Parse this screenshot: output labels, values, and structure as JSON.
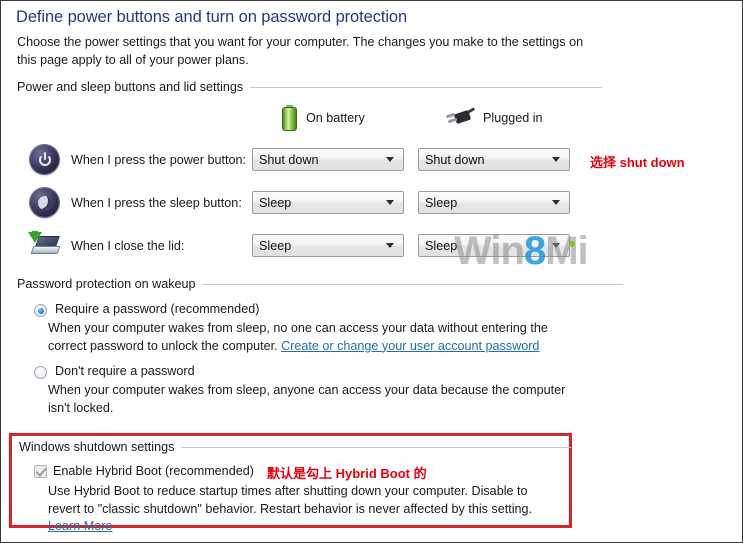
{
  "header": {
    "title": "Define power buttons and turn on password protection",
    "description": "Choose the power settings that you want for your computer. The changes you make to the settings on this page apply to all of your power plans."
  },
  "sections": {
    "power_buttons": {
      "label": "Power and sleep buttons and lid settings",
      "columns": [
        {
          "label": "On battery",
          "icon": "battery-icon"
        },
        {
          "label": "Plugged in",
          "icon": "power-plug-icon"
        }
      ],
      "rows": [
        {
          "icon": "power-button-icon",
          "label": "When I press the power button:",
          "on_battery": "Shut down",
          "plugged_in": "Shut down"
        },
        {
          "icon": "sleep-moon-icon",
          "label": "When I press the sleep button:",
          "on_battery": "Sleep",
          "plugged_in": "Sleep"
        },
        {
          "icon": "laptop-lid-icon",
          "label": "When I close the lid:",
          "on_battery": "Sleep",
          "plugged_in": "Sleep"
        }
      ]
    },
    "password_protection": {
      "label": "Password protection on wakeup",
      "options": [
        {
          "label": "Require a password (recommended)",
          "selected": true,
          "description_before_link": "When your computer wakes from sleep, no one can access your data without entering the correct password to unlock the computer. ",
          "link": "Create or change your user account password"
        },
        {
          "label": "Don't require a password",
          "selected": false,
          "description": "When your computer wakes from sleep, anyone can access your data because the computer isn't locked."
        }
      ]
    },
    "shutdown_settings": {
      "label": "Windows shutdown settings",
      "checkbox": {
        "label": "Enable Hybrid Boot (recommended)",
        "checked": true,
        "disabled": true
      },
      "description_before_link": "Use Hybrid Boot to reduce startup times after shutting down your computer. Disable to revert to \"classic shutdown\" behavior. Restart behavior is never affected by this setting. ",
      "link": "Learn More"
    }
  },
  "annotations": [
    {
      "text": "选择 shut down",
      "color": "#e8000d"
    },
    {
      "text": "默认是勾上 Hybrid Boot 的",
      "color": "#e8000d"
    }
  ],
  "watermark": {
    "prefix": "Win",
    "highlight": "8",
    "suffix": "Mi",
    "highlight_color": "#1996dc"
  },
  "colors": {
    "title": "#1f3d7a",
    "link": "#1f6fb4",
    "annotation": "#e8000d",
    "red_box_border": "#d5252a",
    "battery_green": "#7db648"
  }
}
